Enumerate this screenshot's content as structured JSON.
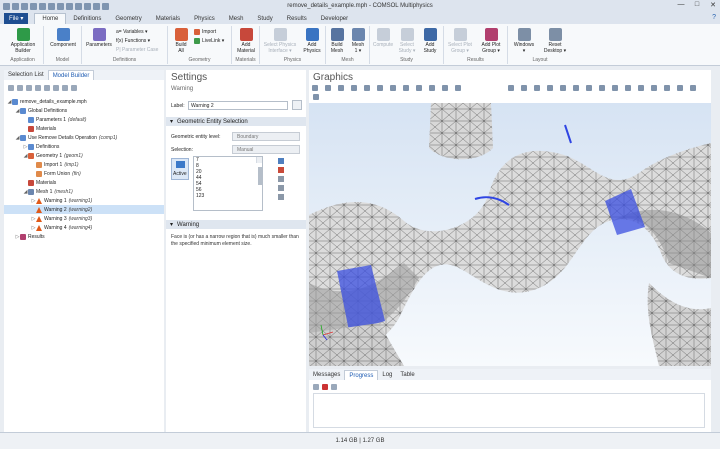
{
  "window": {
    "title": "remove_details_example.mph - COMSOL Multiphysics",
    "min": "—",
    "max": "□",
    "close": "✕"
  },
  "ribbon_tabs": {
    "file": "File ▾",
    "tabs": [
      "Home",
      "Definitions",
      "Geometry",
      "Materials",
      "Physics",
      "Mesh",
      "Study",
      "Results",
      "Developer"
    ]
  },
  "help": "?",
  "ribbon": {
    "application": {
      "builder": "Application\nBuilder",
      "group": "Application"
    },
    "model": {
      "component": "Component",
      "group": "Model"
    },
    "definitions": {
      "parameters": "Parameters",
      "variables": "a= Variables ▾",
      "functions": "f(x) Functions ▾",
      "parameter_case": "P| Parameter Case",
      "group": "Definitions"
    },
    "geometry": {
      "build_all": "Build\nAll",
      "import": "Import",
      "livelink": "LiveLink ▾",
      "group": "Geometry"
    },
    "materials": {
      "add_material": "Add\nMaterial",
      "group": "Materials"
    },
    "physics": {
      "select_physics": "Select Physics\nInterface ▾",
      "add_physics": "Add\nPhysics",
      "group": "Physics"
    },
    "mesh": {
      "build_mesh": "Build\nMesh",
      "mesh1": "Mesh\n1 ▾",
      "group": "Mesh"
    },
    "study": {
      "compute": "Compute",
      "select_study": "Select\nStudy ▾",
      "add_study": "Add\nStudy",
      "group": "Study"
    },
    "results": {
      "select_plot_group": "Select Plot\nGroup ▾",
      "add_plot_group": "Add Plot\nGroup ▾",
      "group": "Results"
    },
    "layout": {
      "windows": "Windows\n▾",
      "reset_desktop": "Reset\nDesktop ▾",
      "group": "Layout"
    }
  },
  "left_panel": {
    "tabs": [
      "Selection List",
      "Model Builder"
    ],
    "tree": [
      {
        "label": "remove_details_example.mph",
        "tag": "",
        "depth": 0,
        "twisty": "◢"
      },
      {
        "label": "Global Definitions",
        "tag": "",
        "depth": 1,
        "twisty": "◢"
      },
      {
        "label": "Parameters 1",
        "tag": "(default)",
        "depth": 2,
        "twisty": ""
      },
      {
        "label": "Materials",
        "tag": "",
        "depth": 2,
        "twisty": ""
      },
      {
        "label": "Use Remove Details Operation",
        "tag": "(comp1)",
        "depth": 1,
        "twisty": "◢"
      },
      {
        "label": "Definitions",
        "tag": "",
        "depth": 2,
        "twisty": "▷"
      },
      {
        "label": "Geometry 1",
        "tag": "(geom1)",
        "depth": 2,
        "twisty": "◢"
      },
      {
        "label": "Import 1",
        "tag": "(imp1)",
        "depth": 3,
        "twisty": ""
      },
      {
        "label": "Form Union",
        "tag": "(fin)",
        "depth": 3,
        "twisty": ""
      },
      {
        "label": "Materials",
        "tag": "",
        "depth": 2,
        "twisty": ""
      },
      {
        "label": "Mesh 1",
        "tag": "(mesh1)",
        "depth": 2,
        "twisty": "◢"
      },
      {
        "label": "Warning 1",
        "tag": "(warning1)",
        "depth": 3,
        "twisty": "▷"
      },
      {
        "label": "Warning 2",
        "tag": "(warning2)",
        "depth": 3,
        "twisty": "",
        "selected": true
      },
      {
        "label": "Warning 3",
        "tag": "(warning3)",
        "depth": 3,
        "twisty": "▷"
      },
      {
        "label": "Warning 4",
        "tag": "(warning4)",
        "depth": 3,
        "twisty": "▷"
      },
      {
        "label": "Results",
        "tag": "",
        "depth": 1,
        "twisty": "▷"
      }
    ]
  },
  "settings": {
    "title": "Settings",
    "subtitle": "Warning",
    "label_caption": "Label:",
    "label_value": "Warning 2",
    "section_geom": "Geometric Entity Selection",
    "entity_level_caption": "Geometric entity level:",
    "entity_level_value": "Boundary",
    "selection_caption": "Selection:",
    "selection_value": "Manual",
    "active_label": "Active",
    "list": [
      "7",
      "8",
      "20",
      "44",
      "54",
      "56",
      "123"
    ],
    "section_warning": "Warning",
    "warning_text": "Face is (or has a narrow region that is) much smaller than the specified minimum element size."
  },
  "graphics": {
    "title": "Graphics"
  },
  "messages": {
    "tabs": [
      "Messages",
      "Progress",
      "Log",
      "Table"
    ]
  },
  "status": {
    "memory": "1.14 GB | 1.27 GB"
  }
}
